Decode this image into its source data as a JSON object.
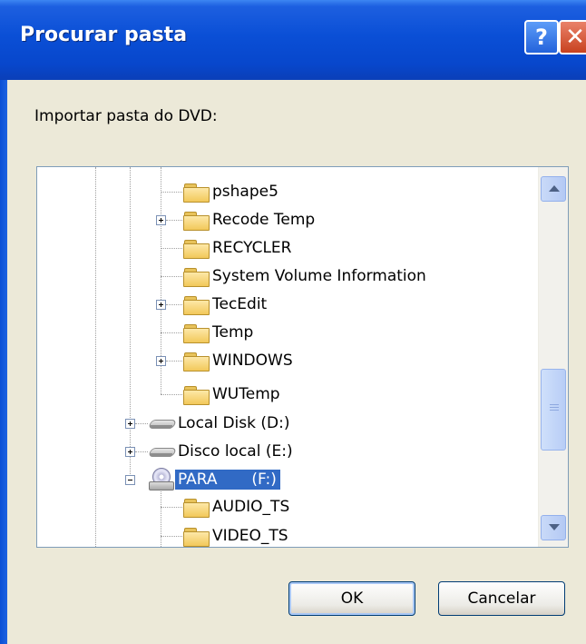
{
  "window": {
    "title": "Procurar pasta",
    "help_button_label": "?",
    "close_button_label": "✕"
  },
  "prompt": "Importar pasta do DVD:",
  "tree": {
    "items": [
      {
        "label": "pshape5",
        "icon": "folder-icon",
        "expander": "none"
      },
      {
        "label": "Recode Temp",
        "icon": "folder-icon",
        "expander": "plus"
      },
      {
        "label": "RECYCLER",
        "icon": "folder-icon",
        "expander": "none"
      },
      {
        "label": "System Volume Information",
        "icon": "folder-icon",
        "expander": "none"
      },
      {
        "label": "TecEdit",
        "icon": "folder-icon",
        "expander": "plus"
      },
      {
        "label": "Temp",
        "icon": "folder-icon",
        "expander": "none"
      },
      {
        "label": "WINDOWS",
        "icon": "folder-icon",
        "expander": "plus"
      },
      {
        "label": "WUTemp",
        "icon": "folder-icon",
        "expander": "none"
      },
      {
        "label": "Local Disk (D:)",
        "icon": "hard-drive-icon",
        "expander": "plus"
      },
      {
        "label": "Disco local (E:)",
        "icon": "hard-drive-icon",
        "expander": "plus"
      },
      {
        "label": "PARA       (F:)",
        "icon": "dvd-drive-icon",
        "expander": "minus",
        "selected": true
      },
      {
        "label": "AUDIO_TS",
        "icon": "folder-icon",
        "expander": "none"
      },
      {
        "label": "VIDEO_TS",
        "icon": "folder-icon",
        "expander": "none"
      }
    ]
  },
  "buttons": {
    "ok": "OK",
    "cancel": "Cancelar"
  },
  "colors": {
    "titlebar": "#0a4fd6",
    "selection": "#316ac5",
    "dialog_background": "#ece9d8"
  }
}
